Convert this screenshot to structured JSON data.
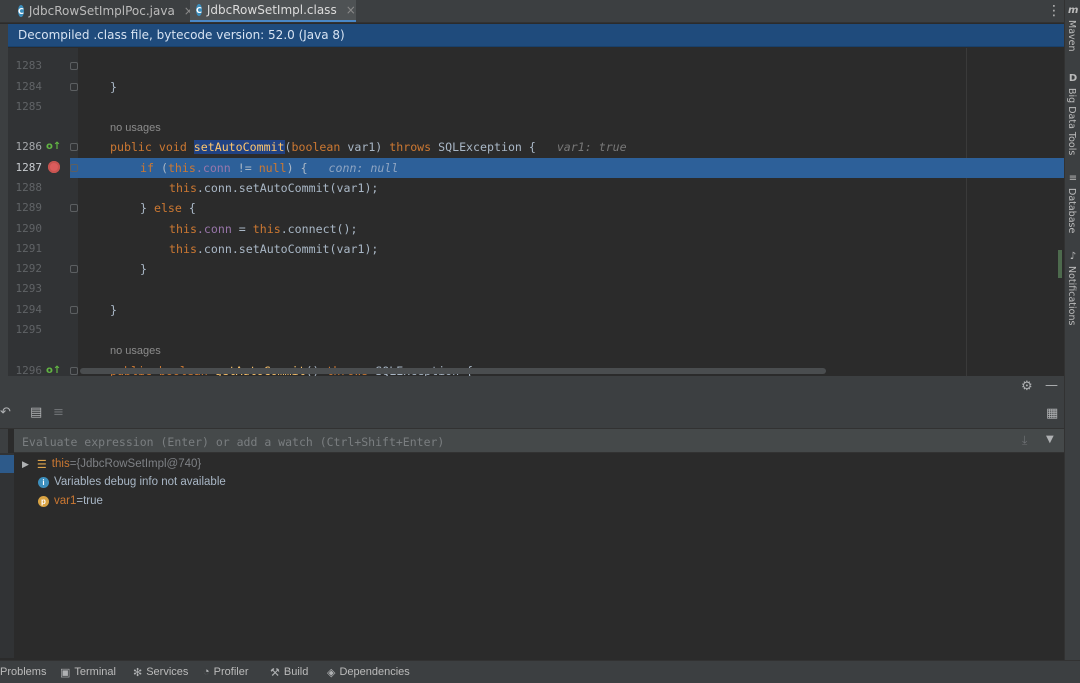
{
  "tabs": [
    {
      "label": "JdbcRowSetImplPoc.java",
      "close": "×",
      "active": false
    },
    {
      "label": "JdbcRowSetImpl.class",
      "close": "×",
      "active": true
    }
  ],
  "banner": "Decompiled .class file, bytecode version: 52.0 (Java 8)",
  "right_tools": {
    "maven": "Maven",
    "big_data_tools": "Big Data Tools",
    "database": "Database",
    "notifications": "Notifications"
  },
  "editor": {
    "line_numbers": [
      "1283",
      "1284",
      "1285",
      "1286",
      "1287",
      "1288",
      "1289",
      "1290",
      "1291",
      "1292",
      "1293",
      "1294",
      "1295",
      "1296"
    ],
    "usage_hint": "no usages",
    "usage_hint_2": "no usages",
    "lines": {
      "l1284_brace": "}",
      "l1286_public": "public",
      "l1286_void": "void",
      "l1286_method": "setAutoCommit",
      "l1286_paren": "(",
      "l1286_boolean": "boolean",
      "l1286_param": "var1)",
      "l1286_throws": "throws",
      "l1286_exc": "SQLException {",
      "l1286_hint": "var1: true",
      "l1287_if": "if",
      "l1287_paren": "(",
      "l1287_this": "this",
      "l1287_conn": ".conn",
      "l1287_neq": " != ",
      "l1287_null": "null",
      "l1287_close": ") {",
      "l1287_hint": "conn: null",
      "l1288_this": "this",
      "l1288_rest": ".conn.setAutoCommit(var1);",
      "l1289_close": "} ",
      "l1289_else": "else",
      "l1289_open": " {",
      "l1290_this": "this",
      "l1290_conn": ".conn",
      "l1290_eq": " = ",
      "l1290_this2": "this",
      "l1290_rest": ".connect();",
      "l1291_this": "this",
      "l1291_rest": ".conn.setAutoCommit(var1);",
      "l1292_brace": "}",
      "l1294_brace": "}",
      "l1296_public": "public",
      "l1296_boolean": "boolean",
      "l1296_method": "getAutoCommit",
      "l1296_paren": "()",
      "l1296_throws": "throws",
      "l1296_exc": "SQLException {"
    }
  },
  "debug": {
    "eval_placeholder": "Evaluate expression (Enter) or add a watch (Ctrl+Shift+Enter)",
    "variables": [
      {
        "name": "this",
        "sep": " = ",
        "value": "{JdbcRowSetImpl@740}"
      },
      {
        "name": "",
        "sep": "",
        "value": "Variables debug info not available"
      },
      {
        "name": "var1",
        "sep": " = ",
        "value": "true"
      }
    ]
  },
  "bottom_tools": [
    "Problems",
    "Terminal",
    "Services",
    "Profiler",
    "Build",
    "Dependencies"
  ],
  "colors": {
    "accent": "#2d6099",
    "banner": "#1f4b7c",
    "keyword": "#cc7832",
    "method": "#ffc66d",
    "field": "#9876aa"
  }
}
